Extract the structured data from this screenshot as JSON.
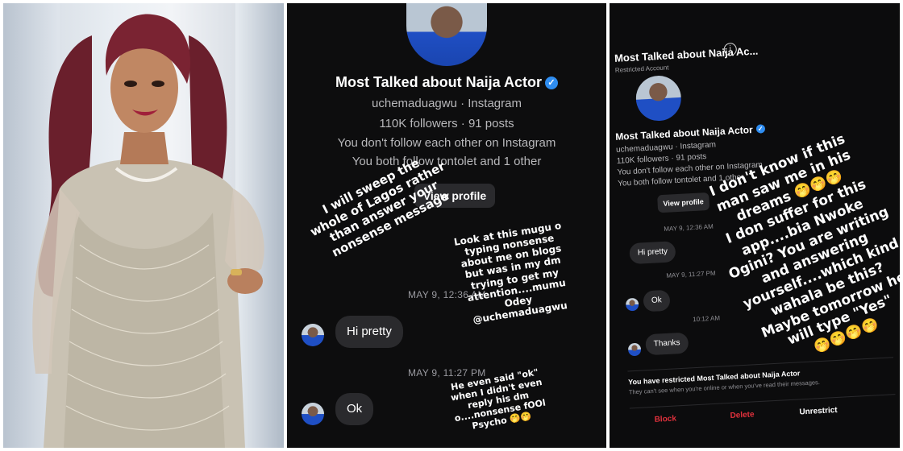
{
  "left_photo": {
    "subject": ""
  },
  "middle": {
    "profile_name": "Most Talked about Naija Actor",
    "handle_line": "uchemaduagwu · Instagram",
    "followers_line": "110K followers · 91 posts",
    "follow_line": "You don't follow each other on Instagram",
    "mutual_line": "You both follow tontolet and 1 other",
    "view_profile_label": "View profile",
    "timestamp_1": "MAY 9, 12:36 AM",
    "message_1": "Hi pretty",
    "timestamp_2": "MAY 9, 11:27 PM",
    "message_2": "Ok",
    "caption_left": "I will sweep the\nwhole of Lagos rather\nthan answer your\nnonsense message",
    "caption_right": "Look at this mugu o\ntyping nonsense\nabout me on blogs\nbut was in my dm\ntrying to get my\nattention....mumu\nOdey\n@uchemaduagwu",
    "caption_bottom": "He even said \"ok\"\nwhen I didn't even\nreply his dm\no....nonsense fOOl\nPsycho 🤭🤭"
  },
  "right": {
    "title": "Most Talked about Naija Ac...",
    "subtitle": "Restricted Account",
    "profile_name": "Most Talked about Naija Actor",
    "handle_line": "uchemaduagwu · Instagram",
    "followers_line": "110K followers · 91 posts",
    "follow_line": "You don't follow each other on Instagram",
    "mutual_line": "You both follow tontolet and 1 other",
    "view_profile_label": "View profile",
    "timestamp_1": "MAY 9, 12:36 AM",
    "message_1": "Hi pretty",
    "timestamp_2": "MAY 9, 11:27 PM",
    "message_2": "Ok",
    "timestamp_3": "10:12 AM",
    "message_3": "Thanks",
    "restricted_notice": "You have restricted Most Talked about Naija Actor",
    "restricted_detail": "They can't see when you're online or when you've read their messages.",
    "block_label": "Block",
    "delete_label": "Delete",
    "unrestrict_label": "Unrestrict",
    "caption": "I don't know if this\nman saw me in his\ndreams 🤭🤭🤭\nI don suffer for this\napp....bia Nwoke\nOgini? You are writing\nand answering\nyourself....which kind\nwahala be this?\nMaybe tomorrow he\nwill type \"Yes\"\n🤭🤭🤭🤭"
  },
  "colors": {
    "accent_red": "#e0313c",
    "verified_blue": "#2f8df0",
    "bubble": "#2a2a2d"
  }
}
